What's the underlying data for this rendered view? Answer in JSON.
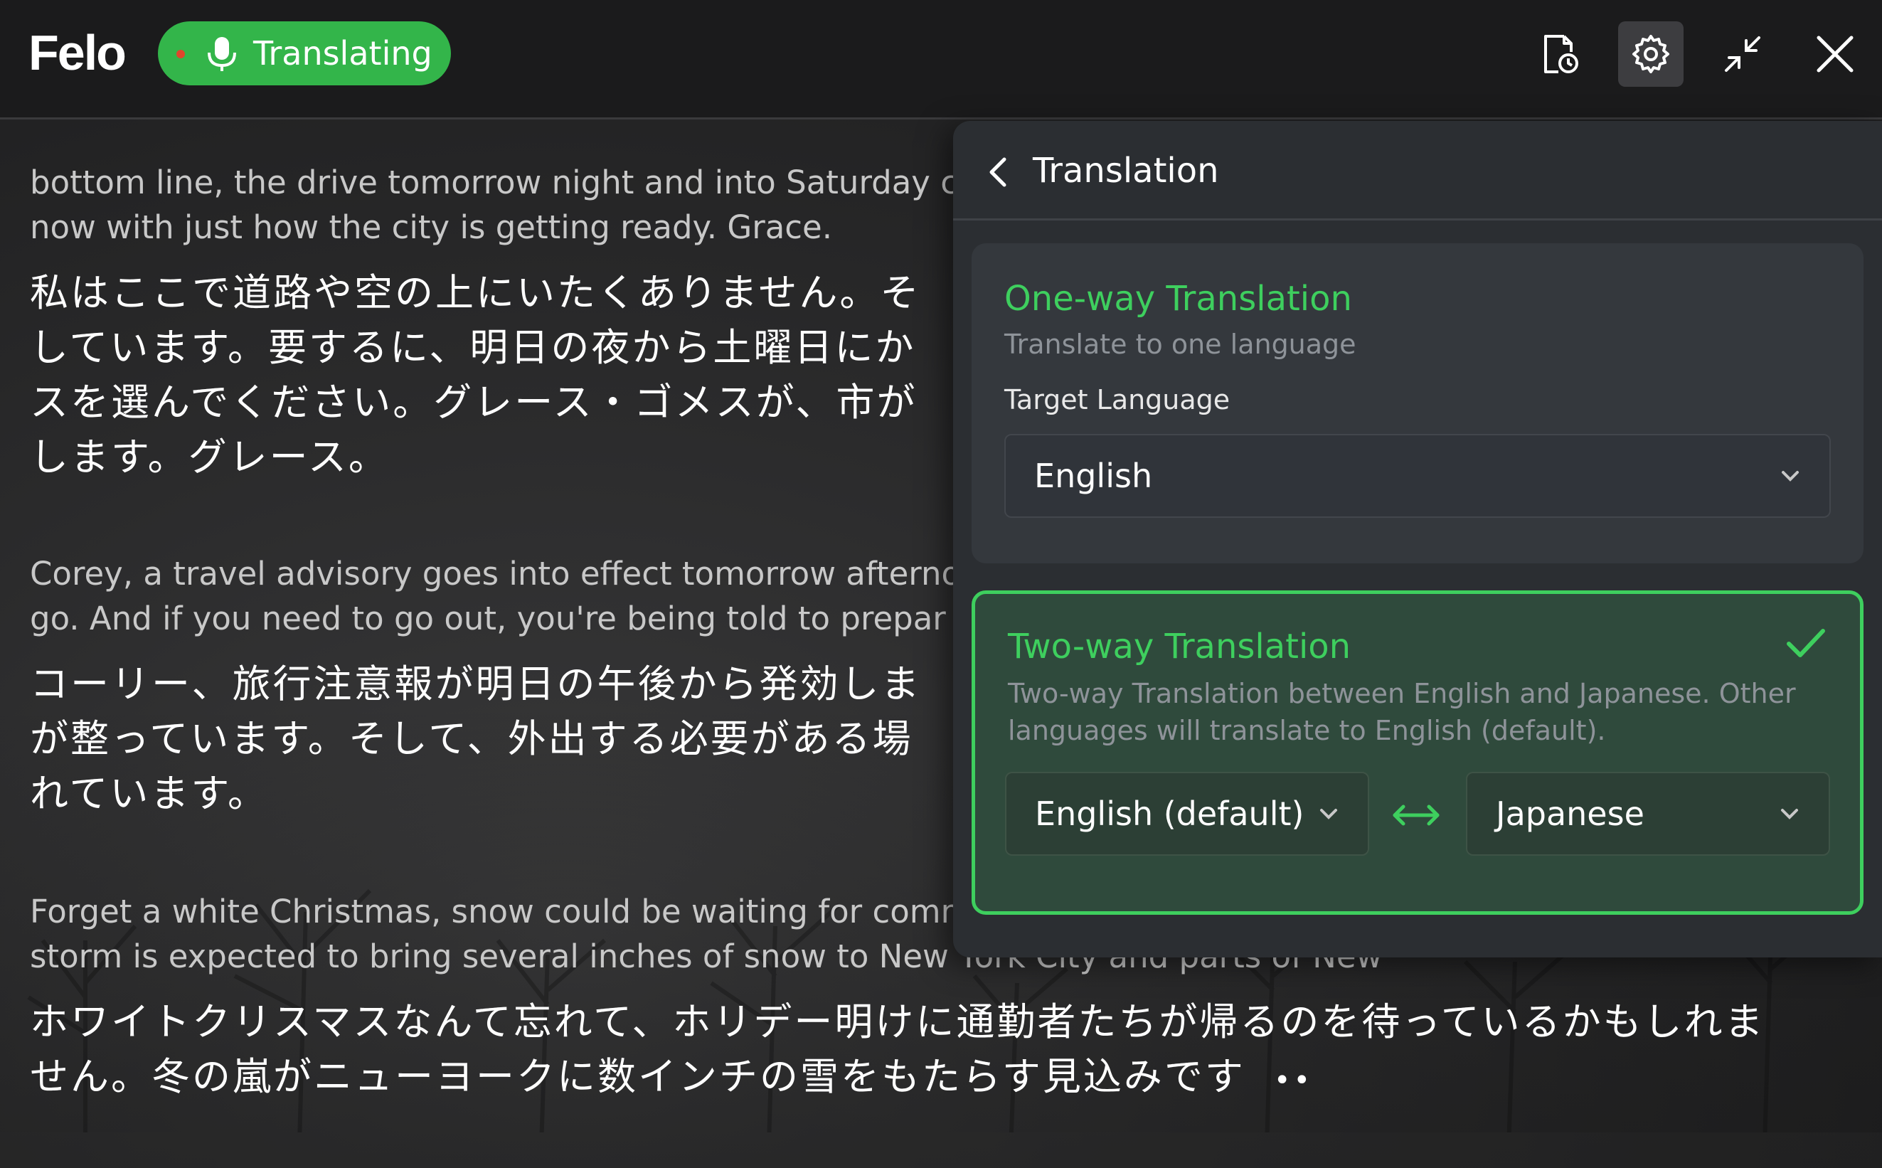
{
  "header": {
    "logo": "Felo",
    "status_label": "Translating",
    "buttons": {
      "history": "history-icon",
      "settings": "gear-icon",
      "minimize": "minimize-icon",
      "close": "close-icon"
    }
  },
  "transcript": {
    "segments": [
      {
        "en": [
          "bottom line, the drive tomorrow night and into Saturday c",
          "now with just how the city is getting ready. Grace."
        ],
        "ja": [
          "私はここで道路や空の上にいたくありません。そ",
          "しています。要するに、明日の夜から土曜日にか",
          "スを選んでください。グレース・ゴメスが、市が",
          "します。グレース。"
        ]
      },
      {
        "en": [
          "Corey, a travel advisory goes into effect tomorrow afterno",
          "go. And if you need to go out, you're being told to prepar"
        ],
        "ja": [
          "コーリー、旅行注意報が明日の午後から発効しま",
          "が整っています。そして、外出する必要がある場",
          "れています。"
        ]
      },
      {
        "en": [
          "Forget a white Christmas, snow could be waiting for comm",
          "storm is expected to bring several inches of snow to New York City and parts of New"
        ],
        "ja": [
          "ホワイトクリスマスなんて忘れて、ホリデー明けに通勤者たちが帰るのを待っているかもしれま",
          "せん。冬の嵐がニューヨークに数インチの雪をもたらす見込みです"
        ],
        "typing": "••"
      }
    ]
  },
  "panel": {
    "title": "Translation",
    "one_way": {
      "title": "One-way Translation",
      "description": "Translate to one language",
      "target_label": "Target Language",
      "target_value": "English"
    },
    "two_way": {
      "title": "Two-way Translation",
      "description": [
        "Two-way Translation between English and Japanese. Other",
        "languages will translate to English (default)."
      ],
      "left_value": "English (default)",
      "right_value": "Japanese",
      "selected": true
    }
  },
  "colors": {
    "accent": "#3ecf5e",
    "pill": "#33b54a",
    "panel": "#2b2e32"
  }
}
